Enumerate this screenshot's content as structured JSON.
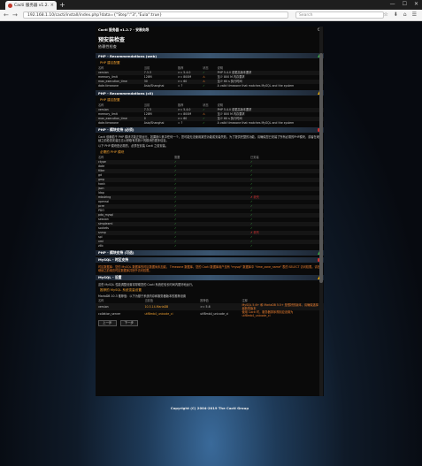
{
  "browser": {
    "tab_title": "Cacti 服务器 v1.2.7 - 维护检查",
    "tab_close": "×",
    "new_tab": "+",
    "window_controls": [
      "—",
      "☐",
      "✕"
    ],
    "back": "←",
    "forward": "→",
    "url": "192.168.1.10/cacti/install/index.php?data={\"Step\":\"3\",\"Eula\":true}",
    "search_placeholder": "Search",
    "toolbar_icons": [
      "☆",
      "⬇",
      "⌂",
      "☰"
    ]
  },
  "panel": {
    "header_title": "Cacti 服务器 v1.2.7 - 安装向导",
    "refresh_icon": "⟳",
    "page_title": "预安装检查",
    "subtitle": "依赖性检查",
    "recommend_web": {
      "title": "PHP - Recommendations (web)",
      "sub": "PHP 建议配置",
      "headers": [
        "名称",
        "当前",
        "推荐",
        "状态",
        "说明"
      ],
      "rows": [
        [
          "version",
          "7.3.3",
          ">= 5.4.0",
          "✓",
          "PHP 5.4.0 或更高版本要求"
        ],
        [
          "memory_limit",
          "128M",
          ">= 800M",
          "⚠",
          "至少 800 M 内存要求"
        ],
        [
          "max_execution_time",
          "30",
          ">= 60",
          "⚠",
          "至少 60 s 执行时间"
        ],
        [
          "date.timezone",
          "Asia/Shanghai",
          "= ?",
          "✓",
          "A valid timezone that matches MySQL and the system"
        ]
      ]
    },
    "recommend_cli": {
      "title": "PHP - Recommendations (cli)",
      "sub": "PHP 建议配置",
      "headers": [
        "名称",
        "当前",
        "推荐",
        "状态",
        "说明"
      ],
      "rows": [
        [
          "version",
          "7.3.3",
          ">= 5.4.0",
          "✓",
          "PHP 5.4.0 或更高版本要求"
        ],
        [
          "memory_limit",
          "128M",
          ">= 800M",
          "⚠",
          "至少 800 M 内存要求"
        ],
        [
          "max_execution_time",
          "0",
          ">= 60",
          "✓",
          "至少 60 s 执行时间"
        ],
        [
          "date.timezone",
          "Asia/Shanghai",
          "= ?",
          "✓",
          "A valid timezone that matches MySQL and the system"
        ]
      ]
    },
    "modules": {
      "title": "PHP - 模块支持 (必须)",
      "para1": "Cacti 依赖若干 PHP 模块才能正常运行。如果缺少其中任何一个，您可能无法使用某些功能或安装失败。为了提供完整的功能，请确保您已安装了所有必需的PHP模块，或者在继续之前检查安装日志以获取有关缺少的模块的更多信息。",
      "para2": "以下 PHP 模块是必需的，必须在安装 Cacti 之前安装。",
      "sub": "必需的 PHP 模块",
      "headers": [
        "名称",
        "需要",
        "已安装"
      ],
      "rows": [
        [
          "ctype",
          "✓",
          "✓"
        ],
        [
          "date",
          "✓",
          "✓"
        ],
        [
          "filter",
          "✓",
          "✓"
        ],
        [
          "gd",
          "✓",
          "✓"
        ],
        [
          "gmp",
          "✓",
          "✓"
        ],
        [
          "hash",
          "✓",
          "✓"
        ],
        [
          "json",
          "✓",
          "✓"
        ],
        [
          "ldap",
          "✓",
          "✓"
        ],
        [
          "mbstring",
          "✓",
          "✗ 缺失"
        ],
        [
          "openssl",
          "✓",
          "✓"
        ],
        [
          "pcre",
          "✓",
          "✓"
        ],
        [
          "PDO",
          "✓",
          "✓"
        ],
        [
          "pdo_mysql",
          "✓",
          "✓"
        ],
        [
          "session",
          "✓",
          "✓"
        ],
        [
          "simplexml",
          "✓",
          "✓"
        ],
        [
          "sockets",
          "✓",
          "✓"
        ],
        [
          "snmp",
          "✓",
          "✗ 缺失"
        ],
        [
          "spl",
          "✓",
          "✓"
        ],
        [
          "xml",
          "✓",
          "✓"
        ],
        [
          "zlib",
          "✓",
          "✓"
        ]
      ]
    },
    "optional": {
      "title": "PHP - 模块支持 (可选)"
    },
    "tz": {
      "title": "MySQL - 时区支持",
      "text": "时区数据库：您的 MySQL 数据库的时区数据尚未加载。 Timezone 数据库，您的 Cacti 数据库用户没有 \"mysql\" 数据库中 \"time_zone_name\" 表的 SELECT 访问权限。请在继续之前填充时区数据库并授予访问权限。"
    },
    "settings": {
      "title": "MySQL - 设置",
      "text": "这些 MySQL 性能调整设置将帮助您的 Cacti 系统在较长时间内更好地运行。",
      "sub": "推荐的 MySQL 系统变量设置",
      "line": "MariaDB 10.3 推荐值：以下为基于系统内存和服务器版本的推荐设置",
      "headers": [
        "名称",
        "当前值",
        "推荐值",
        "注释"
      ],
      "rows": [
        [
          "version",
          "10.3.14-MariaDB",
          ">= 5.6",
          "MySQL 5.6+ 和 MariaDB 5.5+ 是很好的版本，请确保选择最新的版本"
        ],
        [
          "collation_server",
          "utf8mb4_unicode_ci",
          "utf8mb4_unicode_ci",
          "使用 Cacti 时，服务器排序规则应设置为 utf8mb4_unicode_ci"
        ]
      ]
    },
    "buttons": {
      "prev": "上一步",
      "next": "下一步"
    }
  },
  "footer": "Copyright (C) 2004-2019 The Cacti Group"
}
